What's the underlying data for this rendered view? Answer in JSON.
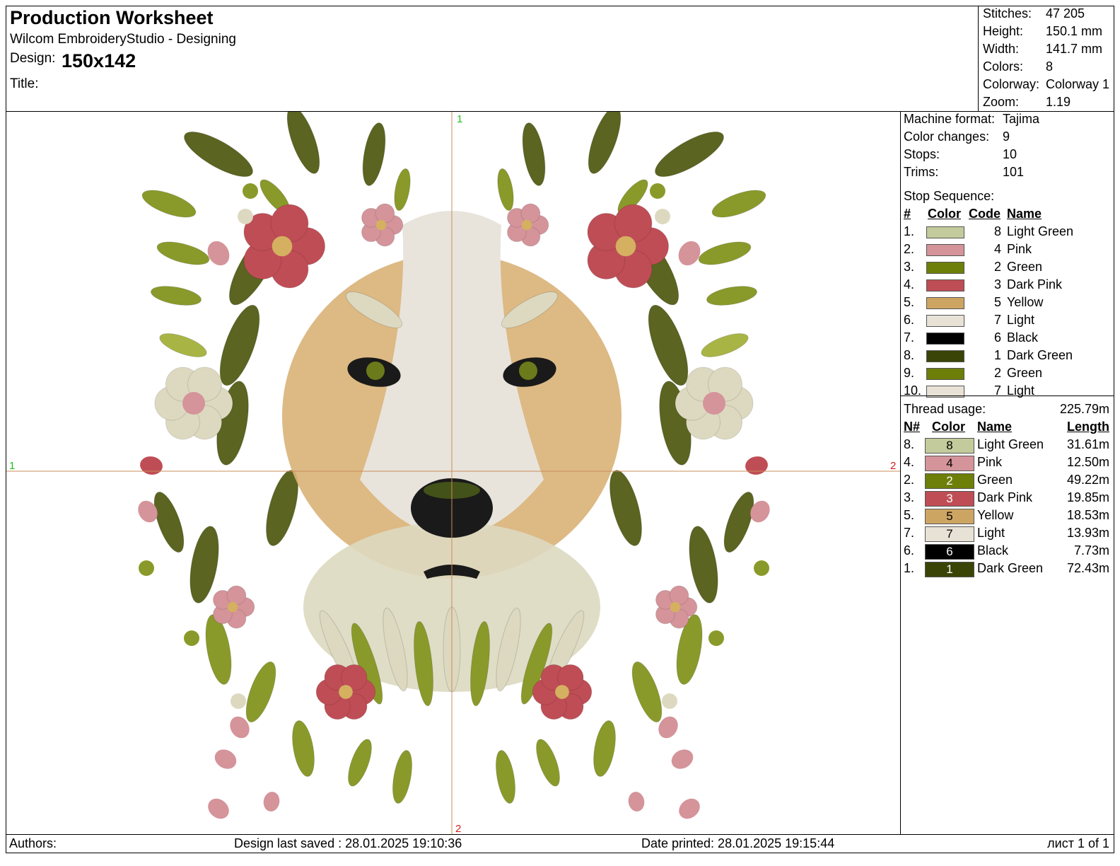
{
  "header": {
    "title": "Production Worksheet",
    "subtitle": "Wilcom EmbroideryStudio - Designing",
    "design_label": "Design:",
    "design_value": "150x142",
    "title_label": "Title:"
  },
  "stats": [
    {
      "label": "Stitches:",
      "value": "47 205"
    },
    {
      "label": "Height:",
      "value": "150.1 mm"
    },
    {
      "label": "Width:",
      "value": "141.7 mm"
    },
    {
      "label": "Colors:",
      "value": "8"
    },
    {
      "label": "Colorway:",
      "value": "Colorway 1"
    },
    {
      "label": "Zoom:",
      "value": "1.19"
    }
  ],
  "machine": [
    {
      "label": "Machine format:",
      "value": "Tajima"
    },
    {
      "label": "Color changes:",
      "value": "9"
    },
    {
      "label": "Stops:",
      "value": "10"
    },
    {
      "label": "Trims:",
      "value": "101"
    }
  ],
  "stop_sequence": {
    "label": "Stop Sequence:",
    "headers": {
      "num": "#",
      "color": "Color",
      "code": "Code",
      "name": "Name"
    },
    "rows": [
      {
        "num": "1.",
        "code": "8",
        "name": "Light Green",
        "color": "#c3cb9c"
      },
      {
        "num": "2.",
        "code": "4",
        "name": "Pink",
        "color": "#d4949a"
      },
      {
        "num": "3.",
        "code": "2",
        "name": "Green",
        "color": "#6e7f09"
      },
      {
        "num": "4.",
        "code": "3",
        "name": "Dark Pink",
        "color": "#bf4d55"
      },
      {
        "num": "5.",
        "code": "5",
        "name": "Yellow",
        "color": "#cda563"
      },
      {
        "num": "6.",
        "code": "7",
        "name": "Light",
        "color": "#e8e2d6"
      },
      {
        "num": "7.",
        "code": "6",
        "name": "Black",
        "color": "#000000"
      },
      {
        "num": "8.",
        "code": "1",
        "name": "Dark Green",
        "color": "#3a4406"
      },
      {
        "num": "9.",
        "code": "2",
        "name": "Green",
        "color": "#6e7f09"
      },
      {
        "num": "10.",
        "code": "7",
        "name": "Light",
        "color": "#e8e2d6"
      }
    ]
  },
  "thread_usage": {
    "label": "Thread usage:",
    "total": "225.79m",
    "headers": {
      "num": "N#",
      "color": "Color",
      "name": "Name",
      "length": "Length"
    },
    "rows": [
      {
        "num": "8.",
        "code": "8",
        "name": "Light Green",
        "length": "31.61m",
        "color": "#c3cb9c",
        "text": "#000000"
      },
      {
        "num": "4.",
        "code": "4",
        "name": "Pink",
        "length": "12.50m",
        "color": "#d4949a",
        "text": "#000000"
      },
      {
        "num": "2.",
        "code": "2",
        "name": "Green",
        "length": "49.22m",
        "color": "#6e7f09",
        "text": "#ffffff"
      },
      {
        "num": "3.",
        "code": "3",
        "name": "Dark Pink",
        "length": "19.85m",
        "color": "#bf4d55",
        "text": "#ffffff"
      },
      {
        "num": "5.",
        "code": "5",
        "name": "Yellow",
        "length": "18.53m",
        "color": "#cda563",
        "text": "#000000"
      },
      {
        "num": "7.",
        "code": "7",
        "name": "Light",
        "length": "13.93m",
        "color": "#e8e2d6",
        "text": "#000000"
      },
      {
        "num": "6.",
        "code": "6",
        "name": "Black",
        "length": "7.73m",
        "color": "#000000",
        "text": "#ffffff"
      },
      {
        "num": "1.",
        "code": "1",
        "name": "Dark Green",
        "length": "72.43m",
        "color": "#3a4406",
        "text": "#ffffff"
      }
    ]
  },
  "axis_markers": {
    "top": "1",
    "left": "1",
    "right": "2",
    "bottom": "2"
  },
  "footer": {
    "authors": "Authors:",
    "saved": "Design last saved : 28.01.2025 19:10:36",
    "printed": "Date printed: 28.01.2025 19:15:44",
    "page": "лист 1 of 1"
  },
  "palette": {
    "leaf_dark": "#5b6420",
    "leaf_mid": "#8a9a2a",
    "leaf_light": "#a8b545",
    "pink": "#d4949a",
    "dark_pink": "#bf4d55",
    "cream": "#ddd9c0",
    "fur": "#d9b177",
    "muzzle": "#e8e4dc",
    "black": "#1a1a1a",
    "center": "#d4b060",
    "guide": "#c98c5a"
  }
}
